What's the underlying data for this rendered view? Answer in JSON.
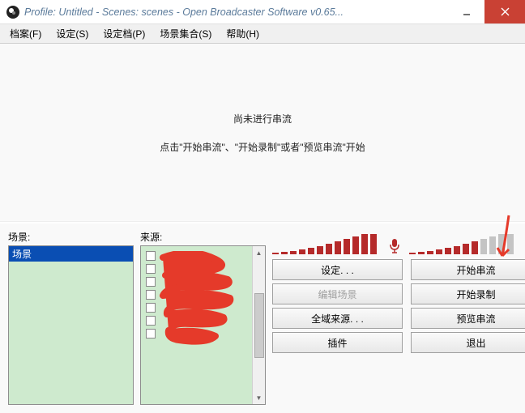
{
  "title": "Profile: Untitled - Scenes: scenes - Open Broadcaster Software v0.65...",
  "menu": {
    "file": "档案(F)",
    "settings": "设定(S)",
    "profile": "设定档(P)",
    "scene_collection": "场景集合(S)",
    "help": "帮助(H)"
  },
  "preview": {
    "line1": "尚未进行串流",
    "line2": "点击\"开始串流\"、\"开始录制\"或者\"预览串流\"开始"
  },
  "labels": {
    "scenes": "场景:",
    "sources": "来源:"
  },
  "scenes": {
    "items": [
      {
        "label": "场景",
        "selected": true
      }
    ]
  },
  "sources": {
    "items": [
      {
        "checked": false
      },
      {
        "checked": false
      },
      {
        "checked": false
      },
      {
        "checked": false
      },
      {
        "checked": false
      },
      {
        "checked": false
      },
      {
        "checked": false
      }
    ]
  },
  "meters": {
    "mic": {
      "levels": [
        2,
        3,
        4,
        6,
        8,
        10,
        13,
        16,
        19,
        22,
        25,
        25
      ],
      "active_count": 12
    },
    "speaker": {
      "levels": [
        2,
        3,
        4,
        6,
        8,
        10,
        13,
        16,
        19,
        22,
        25,
        25
      ],
      "active_count": 8
    }
  },
  "buttons": {
    "settings": "设定. . .",
    "start_stream": "开始串流",
    "edit_scene": "编辑场景",
    "start_record": "开始录制",
    "global_sources": "全域来源. . .",
    "preview_stream": "预览串流",
    "plugins": "插件",
    "exit": "退出"
  },
  "colors": {
    "accent_red": "#b52a2a",
    "close_red": "#c94134",
    "list_bg": "#ceeace",
    "selection": "#0a4eb3"
  }
}
